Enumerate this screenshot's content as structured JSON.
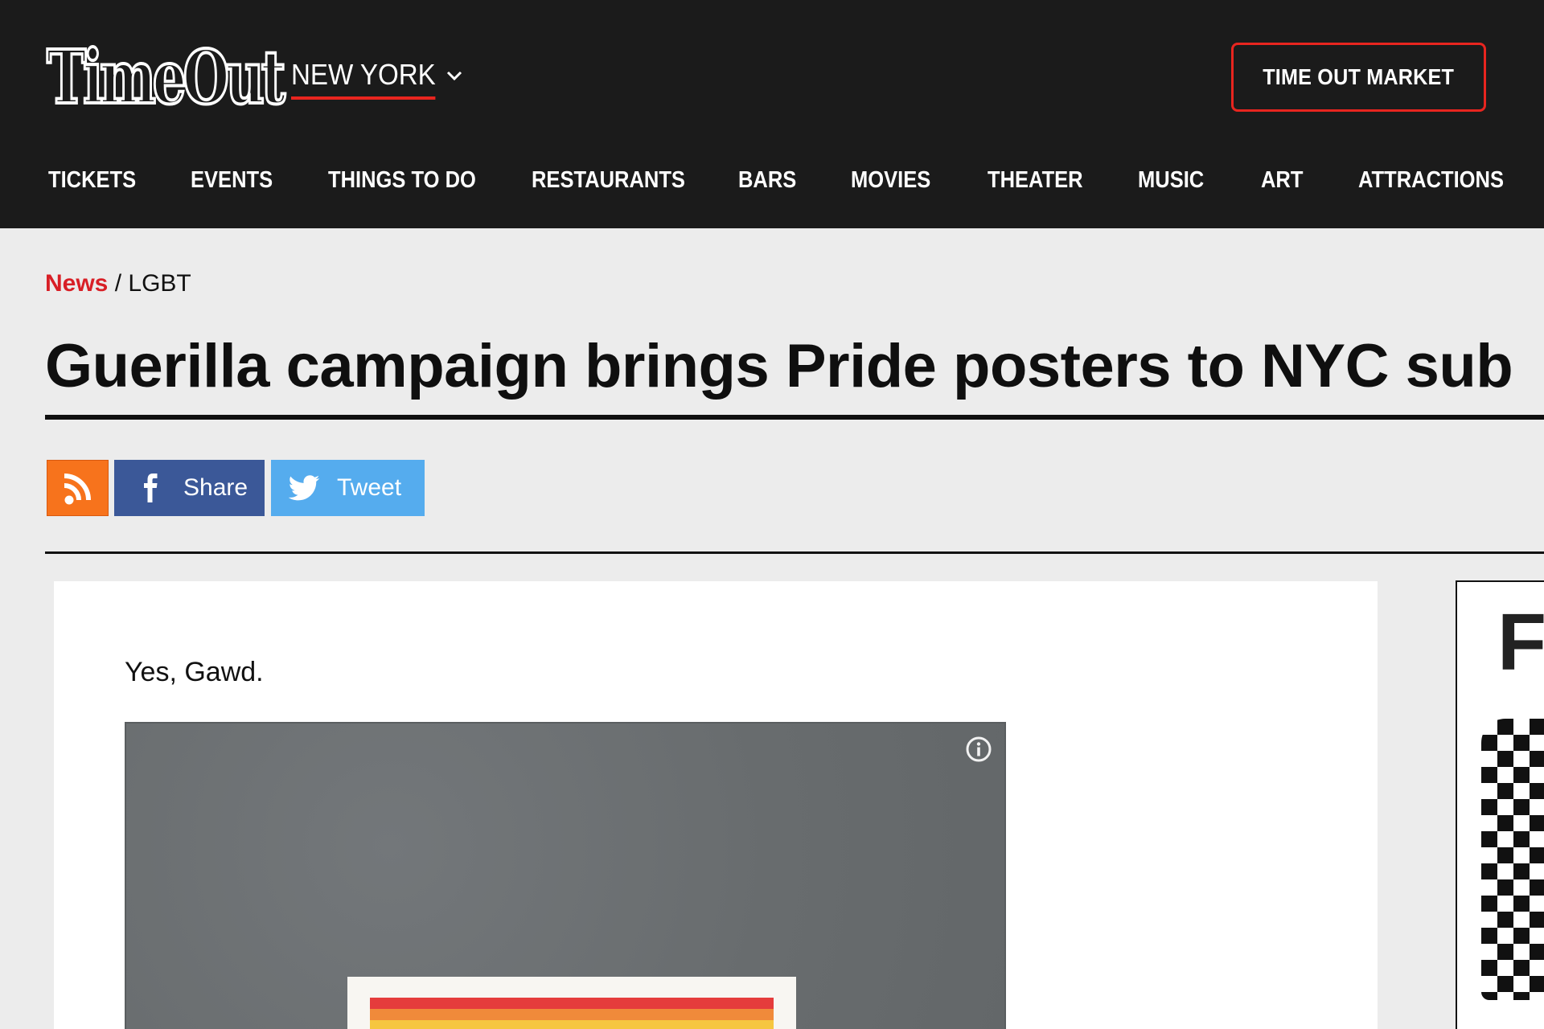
{
  "header": {
    "logo_text": "TimeOut",
    "city": "NEW YORK",
    "market_button": "TIME OUT MARKET"
  },
  "nav": {
    "items": [
      "TICKETS",
      "EVENTS",
      "THINGS TO DO",
      "RESTAURANTS",
      "BARS",
      "MOVIES",
      "THEATER",
      "MUSIC",
      "ART",
      "ATTRACTIONS"
    ]
  },
  "breadcrumb": {
    "section": "News",
    "separator": " / ",
    "category": "LGBT"
  },
  "article": {
    "title": "Guerilla campaign brings Pride posters to NYC sub",
    "intro": "Yes, Gawd."
  },
  "share": {
    "facebook_label": "Share",
    "twitter_label": "Tweet"
  },
  "ad": {
    "letter": "F"
  },
  "colors": {
    "header_bg": "#1b1b1b",
    "accent_red": "#e8251f",
    "rss_orange": "#f7731c",
    "facebook_blue": "#3b5898",
    "twitter_blue": "#55acee",
    "page_bg": "#ececec"
  }
}
